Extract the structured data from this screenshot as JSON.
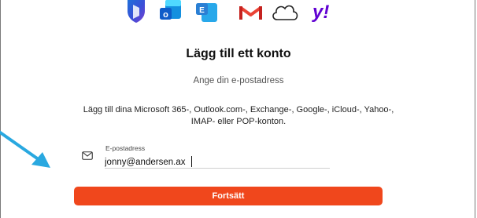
{
  "dialog": {
    "title": "Lägg till ett konto",
    "subtitle": "Ange din e-postadress",
    "description": "Lägg till dina Microsoft 365-, Outlook.com-, Exchange-, Google-, iCloud-, Yahoo-, IMAP- eller POP-konton."
  },
  "providers": [
    {
      "name": "microsoft-365-icon"
    },
    {
      "name": "outlook-icon"
    },
    {
      "name": "exchange-icon",
      "letter": "E"
    },
    {
      "name": "gmail-icon"
    },
    {
      "name": "icloud-icon"
    },
    {
      "name": "yahoo-icon",
      "letter": "y!"
    }
  ],
  "email_field": {
    "label": "E-postadress",
    "value": "jonny@andersen.ax"
  },
  "continue_button": {
    "label": "Fortsätt"
  },
  "colors": {
    "accent": "#f0471c",
    "arrow": "#29a8e0",
    "yahoo": "#6001d2",
    "gmail": "#ea4335",
    "exchange": "#2a7fd4"
  }
}
